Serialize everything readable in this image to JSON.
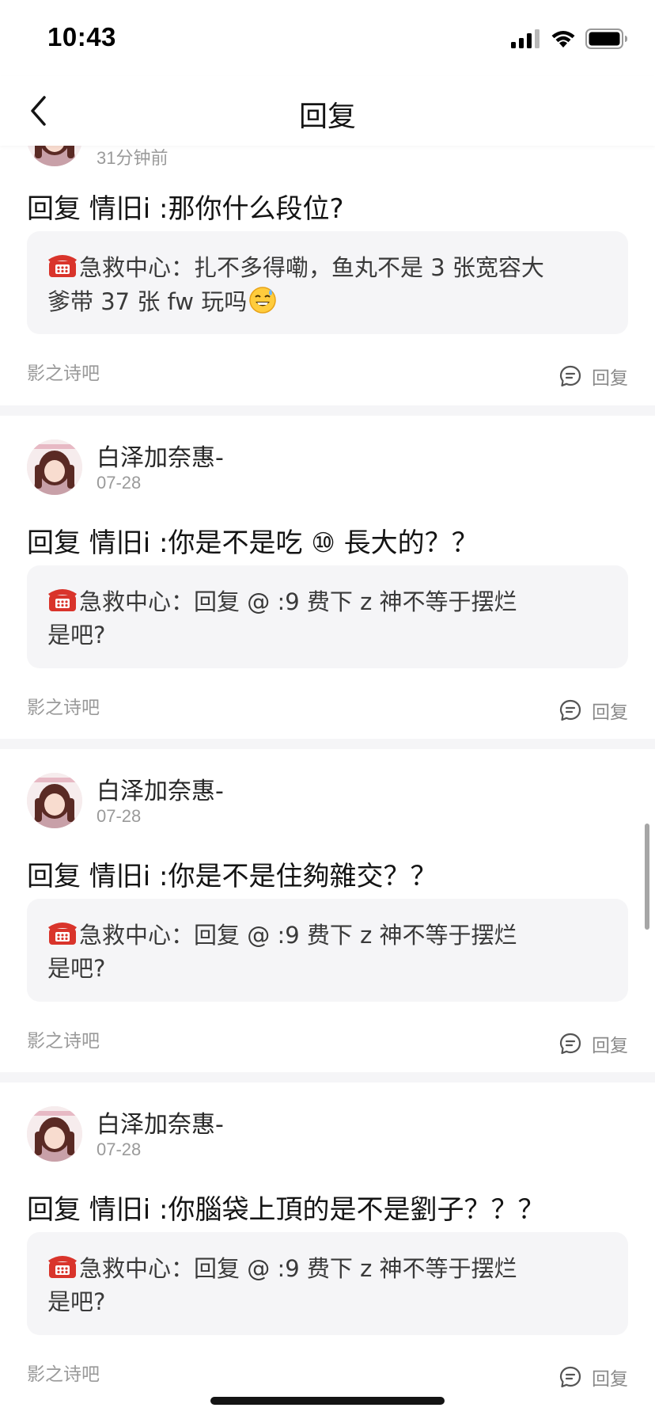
{
  "status_bar": {
    "time": "10:43"
  },
  "nav": {
    "title": "回复"
  },
  "cards": [
    {
      "username": "",
      "timestamp": "31分钟前",
      "reply_text": "回复 情旧i :那你什么段位?",
      "quote_author": "急救中心：",
      "quote_body_1": "扎不多得嘞，鱼丸不是 3 张宽容大",
      "quote_body_2": "爹带 37 张 fw 玩吗",
      "forum": "影之诗吧",
      "reply_label": "回复"
    },
    {
      "username": "白泽加奈惠-",
      "timestamp": "07-28",
      "reply_text": "回复 情旧i :你是不是吃 ⑩ 長大的？？",
      "quote_author": "急救中心：",
      "quote_body_1": "回复 @ :9 费下 z 神不等于摆烂",
      "quote_body_2": "是吧?",
      "forum": "影之诗吧",
      "reply_label": "回复"
    },
    {
      "username": "白泽加奈惠-",
      "timestamp": "07-28",
      "reply_text": "回复 情旧i :你是不是住夠雜交？？",
      "quote_author": "急救中心：",
      "quote_body_1": "回复 @ :9 费下 z 神不等于摆烂",
      "quote_body_2": "是吧?",
      "forum": "影之诗吧",
      "reply_label": "回复"
    },
    {
      "username": "白泽加奈惠-",
      "timestamp": "07-28",
      "reply_text": "回复 情旧i :你腦袋上頂的是不是劉子？？？",
      "quote_author": "急救中心：",
      "quote_body_1": "回复 @ :9 费下 z 神不等于摆烂",
      "quote_body_2": "是吧?",
      "forum": "影之诗吧",
      "reply_label": "回复"
    }
  ],
  "icons": {
    "back": "chevron-left-icon",
    "signal": "cellular-signal-icon",
    "wifi": "wifi-icon",
    "battery": "battery-icon",
    "phone": "telephone-emoji-icon",
    "emoji": "sweat-smile-emoji-icon",
    "comment": "comment-bubble-icon"
  },
  "colors": {
    "text": "#141414",
    "muted": "#9a9a9a",
    "quote_bg": "#f5f5f7",
    "phone": "#d9342b"
  }
}
